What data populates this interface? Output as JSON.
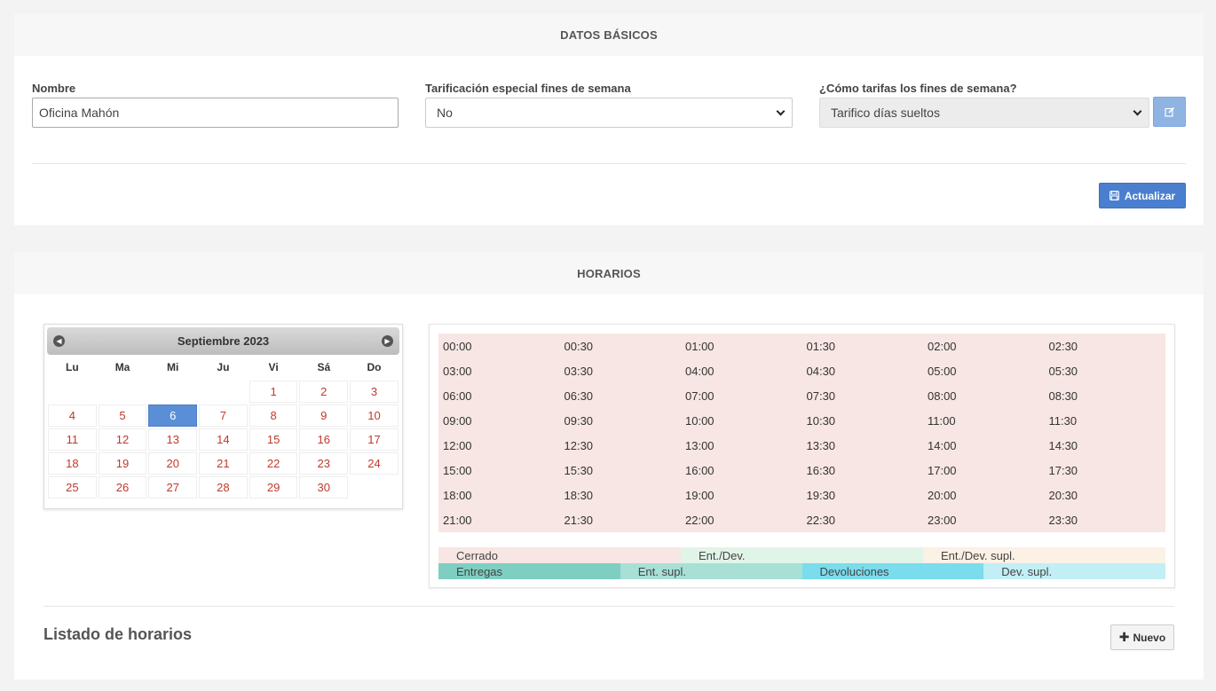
{
  "basic": {
    "title": "DATOS BÁSICOS",
    "nombre_label": "Nombre",
    "nombre_value": "Oficina Mahón",
    "tarif_label": "Tarificación especial fines de semana",
    "tarif_value": "No",
    "como_label": "¿Cómo tarifas los fines de semana?",
    "como_value": "Tarifico días sueltos",
    "update_label": "Actualizar"
  },
  "hours": {
    "title": "HORARIOS",
    "calendar": {
      "month": "Septiembre 2023",
      "weekdays": [
        "Lu",
        "Ma",
        "Mi",
        "Ju",
        "Vi",
        "Sá",
        "Do"
      ],
      "leading_blanks": 4,
      "days": [
        "1",
        "2",
        "3",
        "4",
        "5",
        "6",
        "7",
        "8",
        "9",
        "10",
        "11",
        "12",
        "13",
        "14",
        "15",
        "16",
        "17",
        "18",
        "19",
        "20",
        "21",
        "22",
        "23",
        "24",
        "25",
        "26",
        "27",
        "28",
        "29",
        "30"
      ],
      "selected": "6"
    },
    "times": [
      "00:00",
      "00:30",
      "01:00",
      "01:30",
      "02:00",
      "02:30",
      "03:00",
      "03:30",
      "04:00",
      "04:30",
      "05:00",
      "05:30",
      "06:00",
      "06:30",
      "07:00",
      "07:30",
      "08:00",
      "08:30",
      "09:00",
      "09:30",
      "10:00",
      "10:30",
      "11:00",
      "11:30",
      "12:00",
      "12:30",
      "13:00",
      "13:30",
      "14:00",
      "14:30",
      "15:00",
      "15:30",
      "16:00",
      "16:30",
      "17:00",
      "17:30",
      "18:00",
      "18:30",
      "19:00",
      "19:30",
      "20:00",
      "20:30",
      "21:00",
      "21:30",
      "22:00",
      "22:30",
      "23:00",
      "23:30"
    ],
    "legend_row1": [
      {
        "label": "Cerrado",
        "color": "#f7e6e3"
      },
      {
        "label": "Ent./Dev.",
        "color": "#e1f4e8"
      },
      {
        "label": "Ent./Dev. supl.",
        "color": "#fbf1e4"
      }
    ],
    "legend_row2": [
      {
        "label": "Entregas",
        "color": "#7ecfc2"
      },
      {
        "label": "Ent. supl.",
        "color": "#a8e0d6"
      },
      {
        "label": "Devoluciones",
        "color": "#7adcec"
      },
      {
        "label": "Dev. supl.",
        "color": "#c2eef5"
      }
    ],
    "list_title": "Listado de horarios",
    "new_label": "Nuevo"
  }
}
